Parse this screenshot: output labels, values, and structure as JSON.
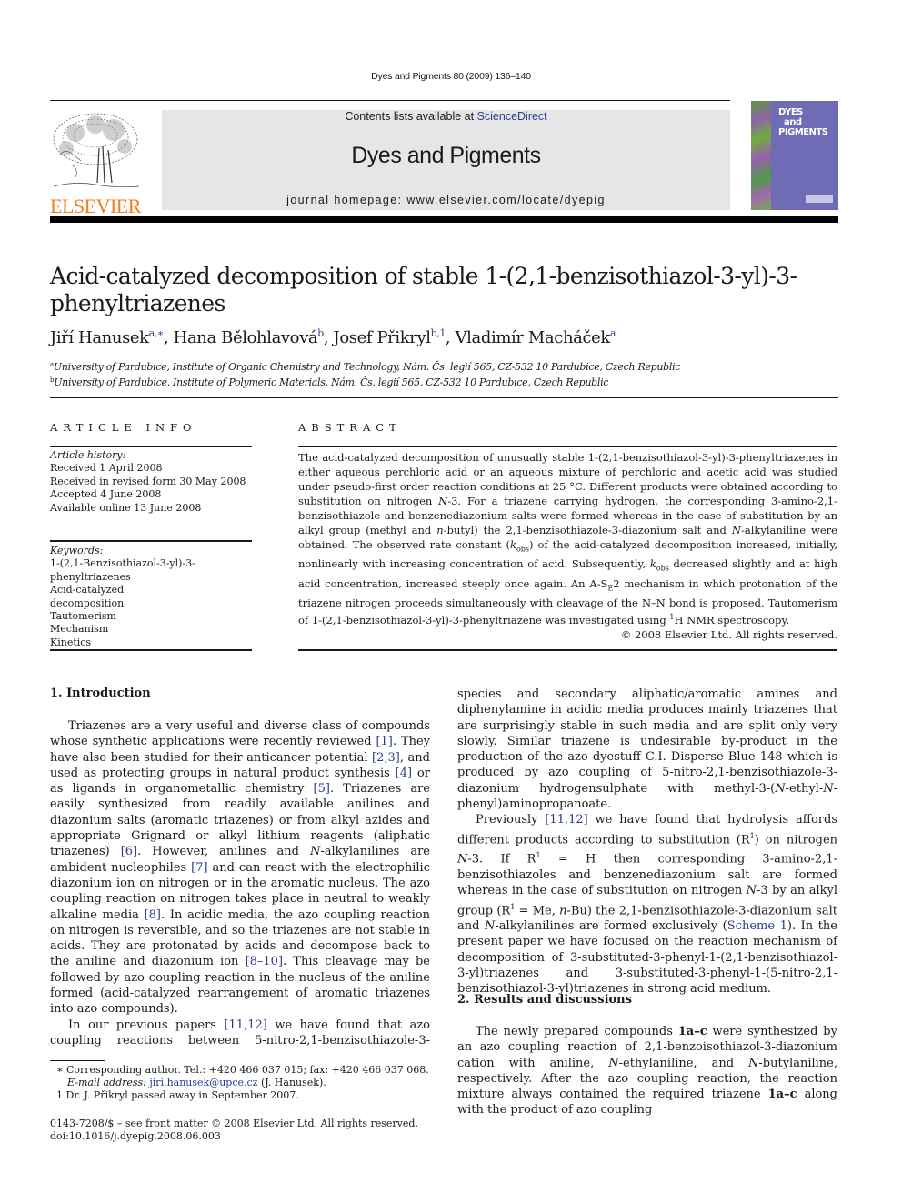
{
  "running_head": "Dyes and Pigments 80 (2009) 136–140",
  "banner": {
    "contents_prefix": "Contents lists available at ",
    "contents_link": "ScienceDirect",
    "journal_title": "Dyes and Pigments",
    "homepage": "journal homepage: www.elsevier.com/locate/dyepig"
  },
  "logo": {
    "publisher": "ELSEVIER",
    "icon": "tree-icon"
  },
  "cover": {
    "line1": "DYES",
    "line2": "and",
    "line3": "PIGMENTS"
  },
  "colors": {
    "publisher_orange": "#f07d1a",
    "link_blue": "#2a3b8f",
    "banner_grey": "#e6e6e6",
    "cover_purple": "#6f6bb5"
  },
  "article": {
    "title": "Acid-catalyzed decomposition of stable 1-(2,1-benzisothiazol-3-yl)-3-phenyltriazenes",
    "authors": [
      {
        "name": "Jiří Hanusek",
        "sup": "a,∗"
      },
      {
        "name": "Hana Bělohlavová",
        "sup": "b"
      },
      {
        "name": "Josef Přikryl",
        "sup": "b,1"
      },
      {
        "name": "Vladimír Macháček",
        "sup": "a"
      }
    ],
    "affiliations": [
      {
        "mark": "a",
        "text": "University of Pardubice, Institute of Organic Chemistry and Technology, Nám. Čs. legií 565, CZ-532 10 Pardubice, Czech Republic"
      },
      {
        "mark": "b",
        "text": "University of Pardubice, Institute of Polymeric Materials, Nám. Čs. legií 565, CZ-532 10 Pardubice, Czech Republic"
      }
    ]
  },
  "article_info": {
    "label": "ARTICLE INFO",
    "history_label": "Article history:",
    "history": [
      "Received 1 April 2008",
      "Received in revised form 30 May 2008",
      "Accepted 4 June 2008",
      "Available online 13 June 2008"
    ],
    "keywords_label": "Keywords:",
    "keywords": [
      "1-(2,1-Benzisothiazol-3-yl)-3-phenyltriazenes",
      "Acid-catalyzed decomposition",
      "Tautomerism",
      "Mechanism",
      "Kinetics"
    ]
  },
  "abstract": {
    "label": "ABSTRACT",
    "p1": "The acid-catalyzed decomposition of unusually stable 1-(2,1-benzisothiazol-3-yl)-3-phenyltriazenes in either aqueous perchloric acid or an aqueous mixture of perchloric and acetic acid was studied under pseudo-first order reaction conditions at 25 °C. Different products were obtained according to substitution on nitrogen ",
    "n3": "N",
    "p2": "-3. For a triazene carrying hydrogen, the corresponding 3-amino-2,1-benzisothiazole and benzenediazonium salts were formed whereas in the case of substitution by an alkyl group (methyl and ",
    "nbu": "n",
    "p3": "-butyl) the 2,1-benzisothiazole-3-diazonium salt and ",
    "nalk": "N",
    "p4": "-alkylaniline were obtained. The observed rate constant (",
    "k": "k",
    "obs": "obs",
    "p5": ") of the acid-catalyzed decomposition increased, initially, nonlinearly with increasing concentration of acid. Subsequently, ",
    "p6": " decreased slightly and at high acid concentration, increased steeply once again. An A-S",
    "se_sub": "E",
    "p7": "2 mechanism in which protonation of the triazene nitrogen proceeds simultaneously with cleavage of the N–N bond is proposed. Tautomerism of 1-(2,1-benzisothiazol-3-yl)-3-phenyltriazene was investigated using ",
    "nmr_sup": "1",
    "p8": "H NMR spectroscopy.",
    "copyright": "© 2008 Elsevier Ltd. All rights reserved."
  },
  "intro": {
    "heading": "1.  Introduction",
    "para1": [
      {
        "t": "Triazenes are a very useful and diverse class of compounds whose synthetic applications were recently reviewed "
      },
      {
        "ref": "[1]"
      },
      {
        "t": ". They have also been studied for their anticancer potential "
      },
      {
        "ref": "[2,3]"
      },
      {
        "t": ", and used as protecting groups in natural product synthesis "
      },
      {
        "ref": "[4]"
      },
      {
        "t": " or as ligands in organometallic chemistry "
      },
      {
        "ref": "[5]"
      },
      {
        "t": ". Triazenes are easily synthesized from readily available anilines and diazonium salts (aromatic triazenes) or from alkyl azides and appropriate Grignard or alkyl lithium reagents (aliphatic triazenes) "
      },
      {
        "ref": "[6]"
      },
      {
        "t": ". However, anilines and "
      },
      {
        "i": "N"
      },
      {
        "t": "-alkylanilines are ambident nucleophiles "
      },
      {
        "ref": "[7]"
      },
      {
        "t": " and can react with the electrophilic diazonium ion on nitrogen or in the aromatic nucleus. The azo coupling reaction on nitrogen takes place in neutral to weakly alkaline media "
      },
      {
        "ref": "[8]"
      },
      {
        "t": ". In acidic media, the azo coupling reaction on nitrogen is reversible, and so the triazenes are not stable in acids. They are protonated by acids and decompose back to the aniline and diazonium ion "
      },
      {
        "ref": "[8–10]"
      },
      {
        "t": ". This cleavage may be followed by azo coupling reaction in the nucleus of the aniline formed (acid-catalyzed rearrangement of aromatic triazenes into azo compounds)."
      }
    ],
    "para2": [
      {
        "t": "In our previous papers "
      },
      {
        "ref": "[11,12]"
      },
      {
        "t": " we have found that azo coupling reactions between 5-nitro-2,1-benzisothiazole-3-diazonium species and secondary aliphatic/aromatic amines and diphenylamine in acidic media produces mainly triazenes that are surprisingly stable in such media and are split only very slowly. Similar triazene is undesirable by-product in the production of the azo dyestuff C.I. Disperse Blue 148 which is produced by azo coupling of 5-nitro-2,1-benzisothiazole-3-diazonium hydrogensulphate with methyl-3-("
      },
      {
        "i": "N"
      },
      {
        "t": "-ethyl-"
      },
      {
        "i": "N"
      },
      {
        "t": "-phenyl)aminopropanoate."
      }
    ],
    "para3": [
      {
        "t": "Previously "
      },
      {
        "ref": "[11,12]"
      },
      {
        "t": " we have found that hydrolysis affords different products according to substitution (R"
      },
      {
        "sup": "1"
      },
      {
        "t": ") on nitrogen "
      },
      {
        "i": "N"
      },
      {
        "t": "-3. If R"
      },
      {
        "sup": "1"
      },
      {
        "t": " = H then corresponding 3-amino-2,1-benzisothiazoles and benzenediazonium salt are formed whereas in the case of substitution on nitrogen "
      },
      {
        "i": "N"
      },
      {
        "t": "-3 by an alkyl group (R"
      },
      {
        "sup": "1"
      },
      {
        "t": " = Me, "
      },
      {
        "i": "n"
      },
      {
        "t": "-Bu) the 2,1-benzisothiazole-3-diazonium salt and "
      },
      {
        "i": "N"
      },
      {
        "t": "-alkylanilines are formed exclusively ("
      },
      {
        "ref": "Scheme 1"
      },
      {
        "t": "). In the present paper we have focused on the reaction mechanism of decomposition of 3-substituted-3-phenyl-1-(2,1-benzisothiazol-3-yl)triazenes and 3-substituted-3-phenyl-1-(5-nitro-2,1-benzisothiazol-3-yl)triazenes in strong acid medium."
      }
    ]
  },
  "results": {
    "heading": "2.  Results and discussions",
    "para1": [
      {
        "t": "The newly prepared compounds "
      },
      {
        "b": "1a–c"
      },
      {
        "t": " were synthesized by an azo coupling reaction of 2,1-benzoisothiazol-3-diazonium cation with aniline, "
      },
      {
        "i": "N"
      },
      {
        "t": "-ethylaniline, and "
      },
      {
        "i": "N"
      },
      {
        "t": "-butylaniline, respectively. After the azo coupling reaction, the reaction mixture always contained the required triazene "
      },
      {
        "b": "1a–c"
      },
      {
        "t": " along with the product of azo coupling"
      }
    ]
  },
  "footnotes": {
    "corresponding": "∗  Corresponding author. Tel.: +420 466 037 015; fax: +420 466 037 068.",
    "email_label": "E-mail address: ",
    "email": "jiri.hanusek@upce.cz",
    "email_suffix": " (J. Hanusek).",
    "note1": "1  Dr. J. Přikryl passed away in September 2007.",
    "issn": "0143-7208/$ – see front matter © 2008 Elsevier Ltd. All rights reserved.",
    "doi": "doi:10.1016/j.dyepig.2008.06.003"
  }
}
